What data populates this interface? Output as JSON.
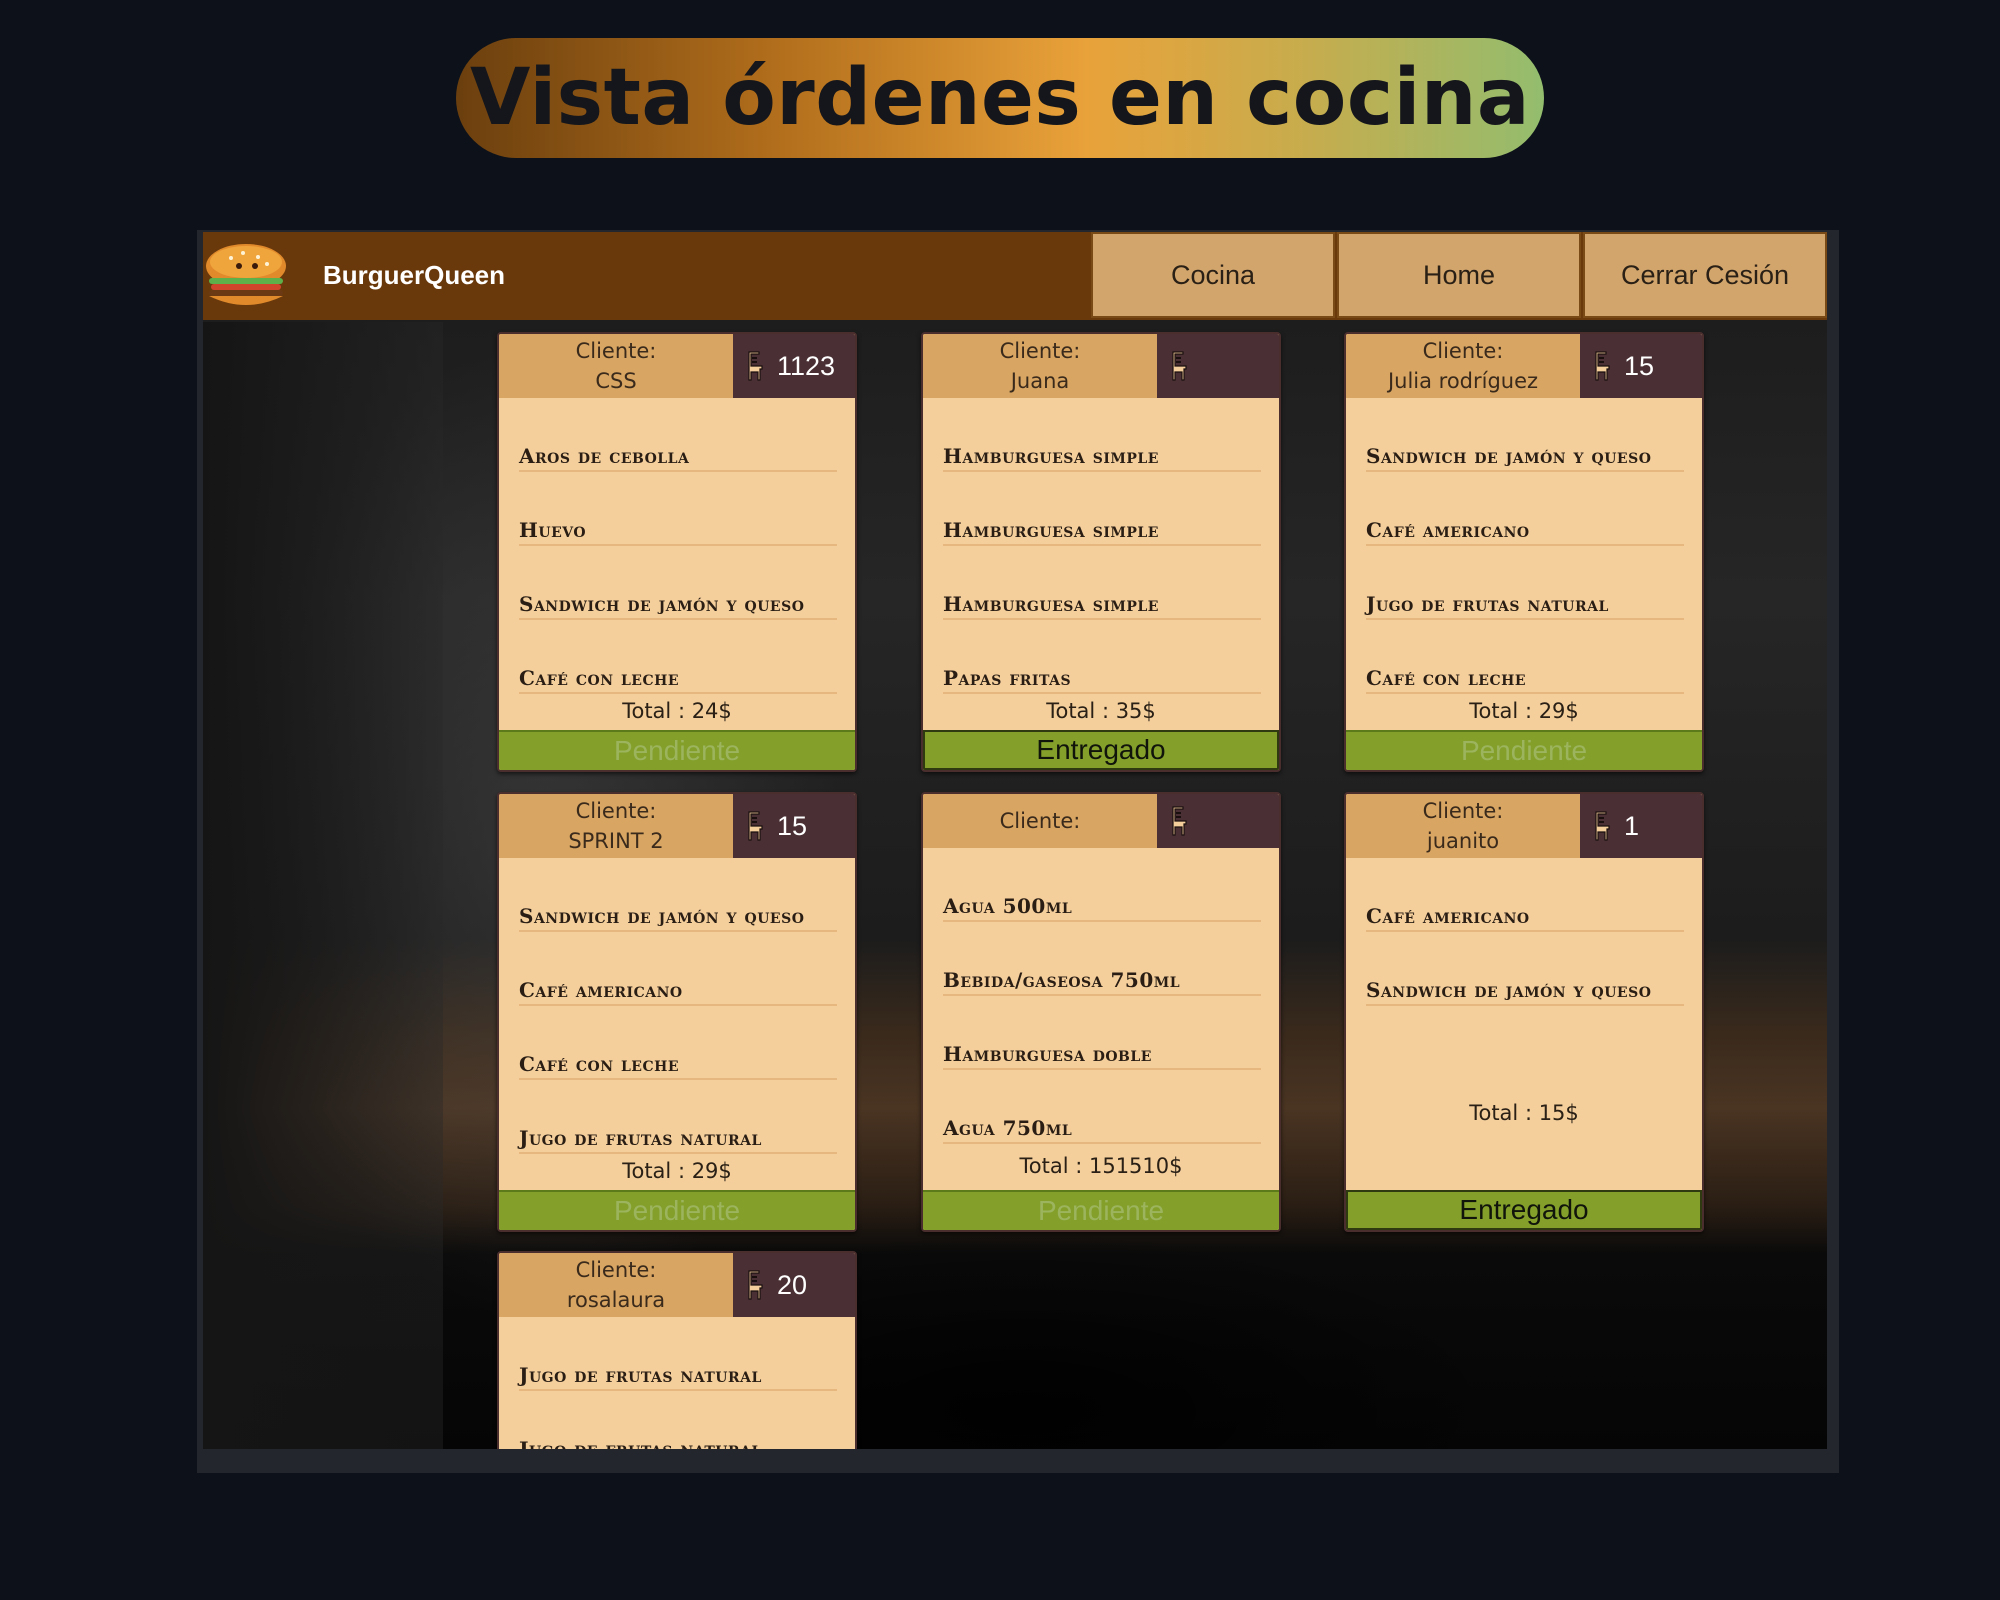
{
  "banner": {
    "title": "Vista órdenes en cocina"
  },
  "navbar": {
    "brand": "BurguerQueen",
    "buttons": [
      "Cocina",
      "Home",
      "Cerrar Cesión"
    ]
  },
  "client_label": "Cliente:",
  "orders": [
    {
      "client": "CSS",
      "table": "1123",
      "items": [
        "Aros de cebolla",
        "Huevo",
        "Sandwich de jamón y queso",
        "Café con leche"
      ],
      "total": "Total : 24$",
      "status": "Pendiente"
    },
    {
      "client": "Juana",
      "table": "",
      "items": [
        "Hamburguesa simple",
        "Hamburguesa simple",
        "Hamburguesa simple",
        "Papas fritas"
      ],
      "total": "Total : 35$",
      "status": "Entregado"
    },
    {
      "client": "Julia rodríguez",
      "table": "15",
      "items": [
        "Sandwich de jamón y queso",
        "Café americano",
        "Jugo de frutas natural",
        "Café con leche"
      ],
      "total": "Total : 29$",
      "status": "Pendiente"
    },
    {
      "client": "SPRINT 2",
      "table": "15",
      "items": [
        "Sandwich de jamón y queso",
        "Café americano",
        "Café con leche",
        "Jugo de frutas natural"
      ],
      "total": "Total : 29$",
      "status": "Pendiente"
    },
    {
      "client": "",
      "table": "",
      "items": [
        "Agua 500ml",
        "Bebida/gaseosa 750ml",
        "Hamburguesa doble",
        "Agua 750ml"
      ],
      "total": "Total : 151510$",
      "status": "Pendiente"
    },
    {
      "client": "juanito",
      "table": "1",
      "items": [
        "Café americano",
        "Sandwich de jamón y queso"
      ],
      "total": "Total : 15$",
      "status": "Entregado"
    },
    {
      "client": "rosalaura",
      "table": "20",
      "items": [
        "Jugo de frutas natural",
        "Jugo de frutas natural"
      ],
      "total": "",
      "status": ""
    }
  ],
  "colors": {
    "navbar": "#6a390b",
    "nav_button": "#d2a56c",
    "card": "#f4cf9c",
    "card_header": "#d8a562",
    "table_badge": "#4a3034",
    "status_bar": "#84a02b"
  },
  "icons": {
    "table": "chair-icon",
    "logo": "burger-logo"
  }
}
